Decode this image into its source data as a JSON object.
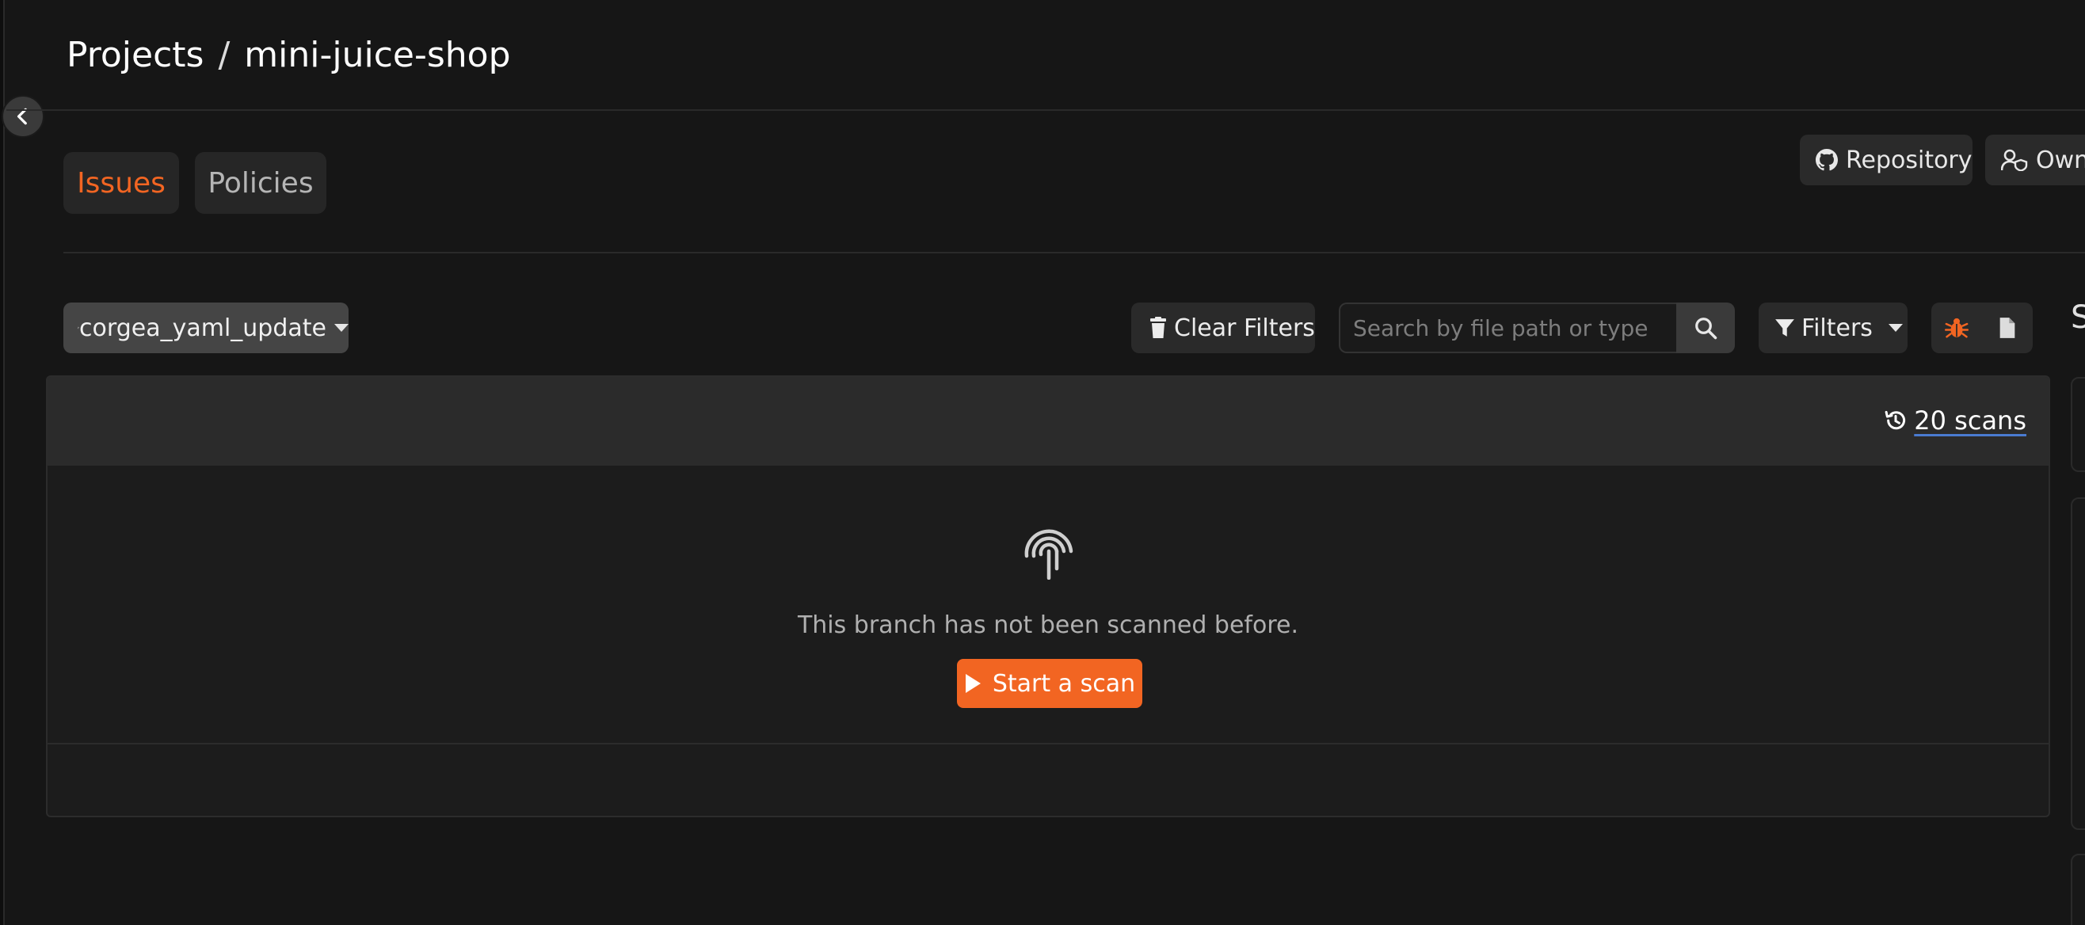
{
  "breadcrumb": {
    "projects": "Projects",
    "separator": "/",
    "project_name": "mini-juice-shop"
  },
  "tabs": [
    {
      "label": "Issues",
      "active": true
    },
    {
      "label": "Policies",
      "active": false
    }
  ],
  "header_actions": {
    "repository_label": "Repository",
    "owners_label": "Owne"
  },
  "toolbar": {
    "branch": "corgea_yaml_update",
    "clear_filters_label": "Clear Filters",
    "search_placeholder": "Search by file path or type",
    "filters_label": "Filters"
  },
  "side_panel": {
    "partial_heading": "S"
  },
  "panel": {
    "scans_label": "20 scans",
    "empty_message": "This branch has not been scanned before.",
    "start_scan_label": "Start a scan"
  },
  "colors": {
    "accent": "#f26522",
    "background": "#161616",
    "panel_header": "#2b2b2b",
    "link_underline": "#4a7bd1"
  },
  "icons": {
    "collapse": "chevron-left-icon",
    "repository": "github-icon",
    "owners": "user-shield-icon",
    "branch": "git-branch-icon",
    "clear": "trash-icon",
    "search": "search-icon",
    "filters": "funnel-icon",
    "issues_view": "bug-icon",
    "files_view": "file-icon",
    "scans": "history-icon",
    "empty": "fingerprint-icon",
    "start": "play-icon"
  }
}
